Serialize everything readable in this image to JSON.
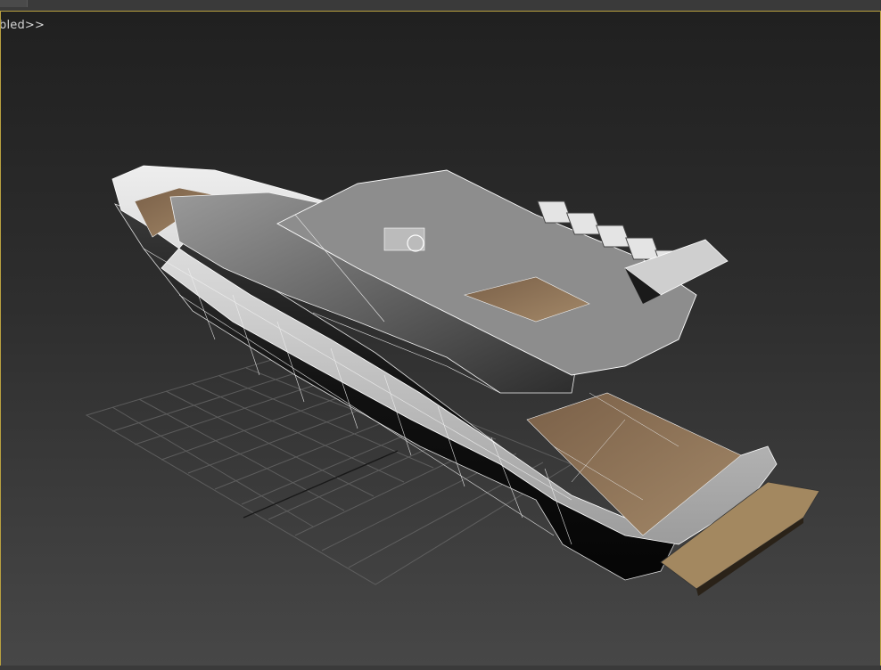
{
  "viewport": {
    "label": "bled>>",
    "background_top": "#202020",
    "background_bottom": "#474747",
    "border_color": "#b8a040"
  },
  "scene": {
    "object": "yacht-model",
    "display_mode": "shaded-with-edged-faces",
    "hull_color": "#c8c8c8",
    "deck_color": "#8a6f55",
    "grid_color": "#6a6a6a"
  }
}
